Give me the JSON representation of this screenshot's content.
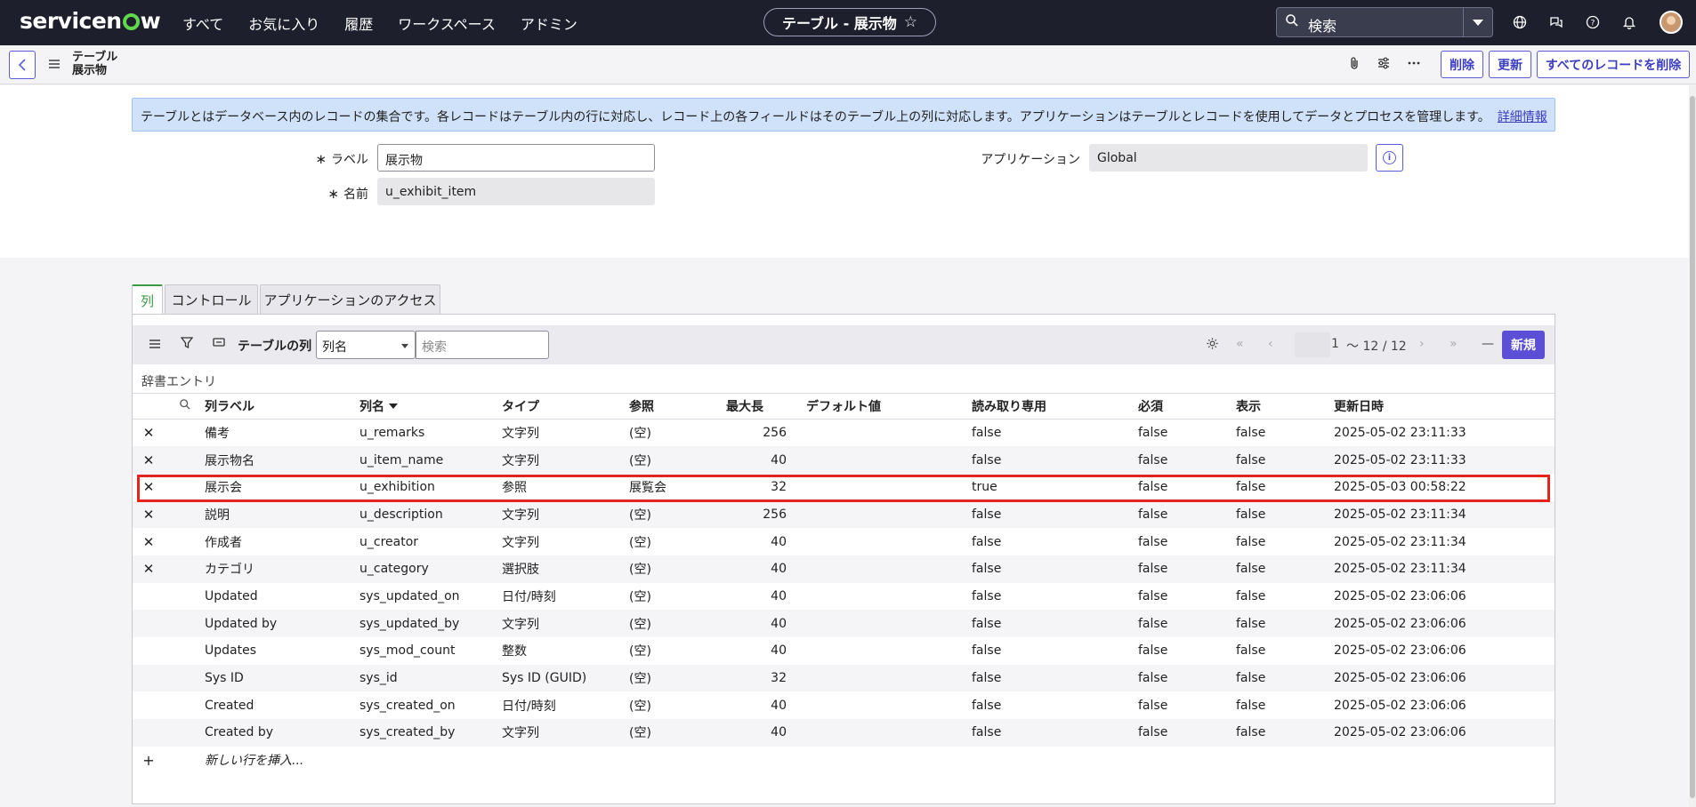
{
  "topnav": {
    "brand": "servicenow",
    "menu": [
      "すべて",
      "お気に入り",
      "履歴",
      "ワークスペース",
      "アドミン"
    ],
    "context_title": "テーブル - 展示物",
    "search_placeholder": "検索"
  },
  "form_header": {
    "title_line1": "テーブル",
    "title_line2": "展示物",
    "buttons": [
      "削除",
      "更新",
      "すべてのレコードを削除"
    ]
  },
  "form": {
    "info_text": "テーブルとはデータベース内のレコードの集合です。各レコードはテーブル内の行に対応し、レコード上の各フィールドはそのテーブル上の列に対応します。アプリケーションはテーブルとレコードを使用してデータとプロセスを管理します。",
    "info_link": "詳細情報",
    "label_label": "ラベル",
    "label_value": "展示物",
    "name_label": "名前",
    "name_value": "u_exhibit_item",
    "app_label": "アプリケーション",
    "app_value": "Global"
  },
  "tabs": [
    "列",
    "コントロール",
    "アプリケーションのアクセス"
  ],
  "list": {
    "title": "テーブルの列",
    "filter_select": "列名",
    "search_placeholder": "検索",
    "pager_start": "1",
    "pager_range": "～ 12 / 12",
    "new_button": "新規",
    "dict_label": "辞書エントリ",
    "columns": [
      "列ラベル",
      "列名",
      "タイプ",
      "参照",
      "最大長",
      "デフォルト値",
      "読み取り専用",
      "必須",
      "表示",
      "更新日時"
    ],
    "rows": [
      {
        "del": true,
        "label": "備考",
        "name": "u_remarks",
        "type": "文字列",
        "ref": "(空)",
        "max": "256",
        "def": "",
        "ro": "false",
        "req": "false",
        "disp": "false",
        "updated": "2025-05-02 23:11:33"
      },
      {
        "del": true,
        "label": "展示物名",
        "name": "u_item_name",
        "type": "文字列",
        "ref": "(空)",
        "max": "40",
        "def": "",
        "ro": "false",
        "req": "false",
        "disp": "false",
        "updated": "2025-05-02 23:11:33"
      },
      {
        "del": true,
        "label": "展示会",
        "name": "u_exhibition",
        "type": "参照",
        "ref": "展覧会",
        "max": "32",
        "def": "",
        "ro": "true",
        "req": "false",
        "disp": "false",
        "updated": "2025-05-03 00:58:22"
      },
      {
        "del": true,
        "label": "説明",
        "name": "u_description",
        "type": "文字列",
        "ref": "(空)",
        "max": "256",
        "def": "",
        "ro": "false",
        "req": "false",
        "disp": "false",
        "updated": "2025-05-02 23:11:34"
      },
      {
        "del": true,
        "label": "作成者",
        "name": "u_creator",
        "type": "文字列",
        "ref": "(空)",
        "max": "40",
        "def": "",
        "ro": "false",
        "req": "false",
        "disp": "false",
        "updated": "2025-05-02 23:11:34"
      },
      {
        "del": true,
        "label": "カテゴリ",
        "name": "u_category",
        "type": "選択肢",
        "ref": "(空)",
        "max": "40",
        "def": "",
        "ro": "false",
        "req": "false",
        "disp": "false",
        "updated": "2025-05-02 23:11:34"
      },
      {
        "del": false,
        "label": "Updated",
        "name": "sys_updated_on",
        "type": "日付/時刻",
        "ref": "(空)",
        "max": "40",
        "def": "",
        "ro": "false",
        "req": "false",
        "disp": "false",
        "updated": "2025-05-02 23:06:06"
      },
      {
        "del": false,
        "label": "Updated by",
        "name": "sys_updated_by",
        "type": "文字列",
        "ref": "(空)",
        "max": "40",
        "def": "",
        "ro": "false",
        "req": "false",
        "disp": "false",
        "updated": "2025-05-02 23:06:06"
      },
      {
        "del": false,
        "label": "Updates",
        "name": "sys_mod_count",
        "type": "整数",
        "ref": "(空)",
        "max": "40",
        "def": "",
        "ro": "false",
        "req": "false",
        "disp": "false",
        "updated": "2025-05-02 23:06:06"
      },
      {
        "del": false,
        "label": "Sys ID",
        "name": "sys_id",
        "type": "Sys ID (GUID)",
        "ref": "(空)",
        "max": "32",
        "def": "",
        "ro": "false",
        "req": "false",
        "disp": "false",
        "updated": "2025-05-02 23:06:06"
      },
      {
        "del": false,
        "label": "Created",
        "name": "sys_created_on",
        "type": "日付/時刻",
        "ref": "(空)",
        "max": "40",
        "def": "",
        "ro": "false",
        "req": "false",
        "disp": "false",
        "updated": "2025-05-02 23:06:06"
      },
      {
        "del": false,
        "label": "Created by",
        "name": "sys_created_by",
        "type": "文字列",
        "ref": "(空)",
        "max": "40",
        "def": "",
        "ro": "false",
        "req": "false",
        "disp": "false",
        "updated": "2025-05-02 23:06:06"
      }
    ],
    "insert_row": "新しい行を挿入..."
  },
  "colors": {
    "nav_bg": "#1d1f2c",
    "accent": "#5b4fd6",
    "link": "#4b3fcf",
    "delete": "#c4211b",
    "highlight": "#e3251d",
    "active_tab": "#3f9a45"
  }
}
